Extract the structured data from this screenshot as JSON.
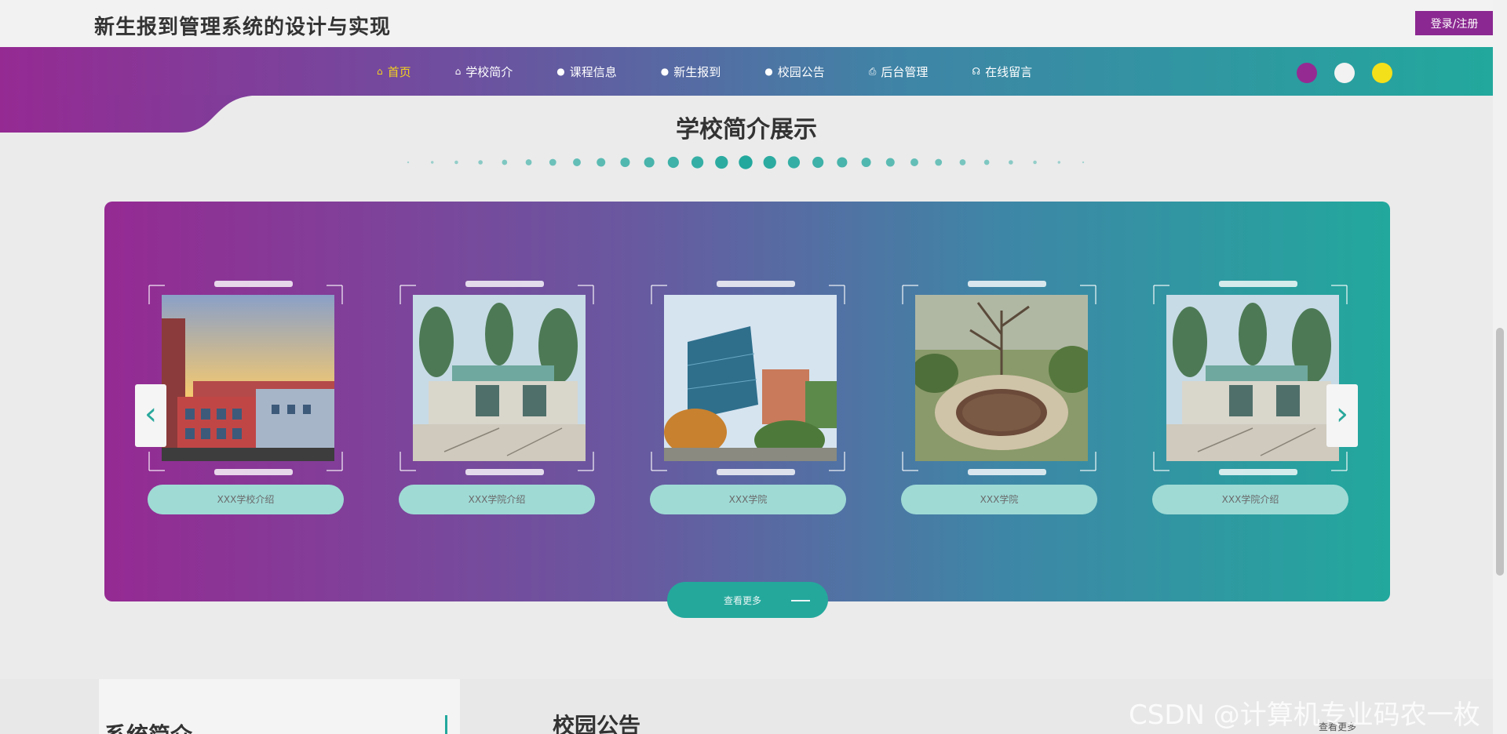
{
  "header": {
    "title": "新生报到管理系统的设计与实现",
    "login_label": "登录/注册"
  },
  "nav": {
    "items": [
      {
        "label": "首页",
        "icon": "home-icon",
        "glyph": "⌂"
      },
      {
        "label": "学校简介",
        "icon": "bag-icon",
        "glyph": "⌂"
      },
      {
        "label": "课程信息",
        "icon": "circle-icon",
        "glyph": "●"
      },
      {
        "label": "新生报到",
        "icon": "circle-icon",
        "glyph": "●"
      },
      {
        "label": "校园公告",
        "icon": "circle-icon",
        "glyph": "●"
      },
      {
        "label": "后台管理",
        "icon": "printer-icon",
        "glyph": "⎙"
      },
      {
        "label": "在线留言",
        "icon": "headset-icon",
        "glyph": "☊"
      }
    ],
    "active_index": 0
  },
  "theme_dots": [
    "#952a93",
    "#f2f2f2",
    "#f4e01a"
  ],
  "colors": {
    "accent_purple": "#952a93",
    "accent_teal": "#22a89d",
    "active_nav": "#f4d21f"
  },
  "section": {
    "title": "学校简介展示"
  },
  "carousel": {
    "prev_glyph": "‹",
    "next_glyph": "›",
    "more_label": "查看更多",
    "cards": [
      {
        "caption": "XXX学校介绍"
      },
      {
        "caption": "XXX学院介绍"
      },
      {
        "caption": "XXX学院"
      },
      {
        "caption": "XXX学院"
      },
      {
        "caption": "XXX学院介绍"
      }
    ]
  },
  "bottom": {
    "left_title": "系统简介",
    "right_title": "校园公告",
    "more_link": "查看更多"
  },
  "watermark": "CSDN @计算机专业码农一枚"
}
